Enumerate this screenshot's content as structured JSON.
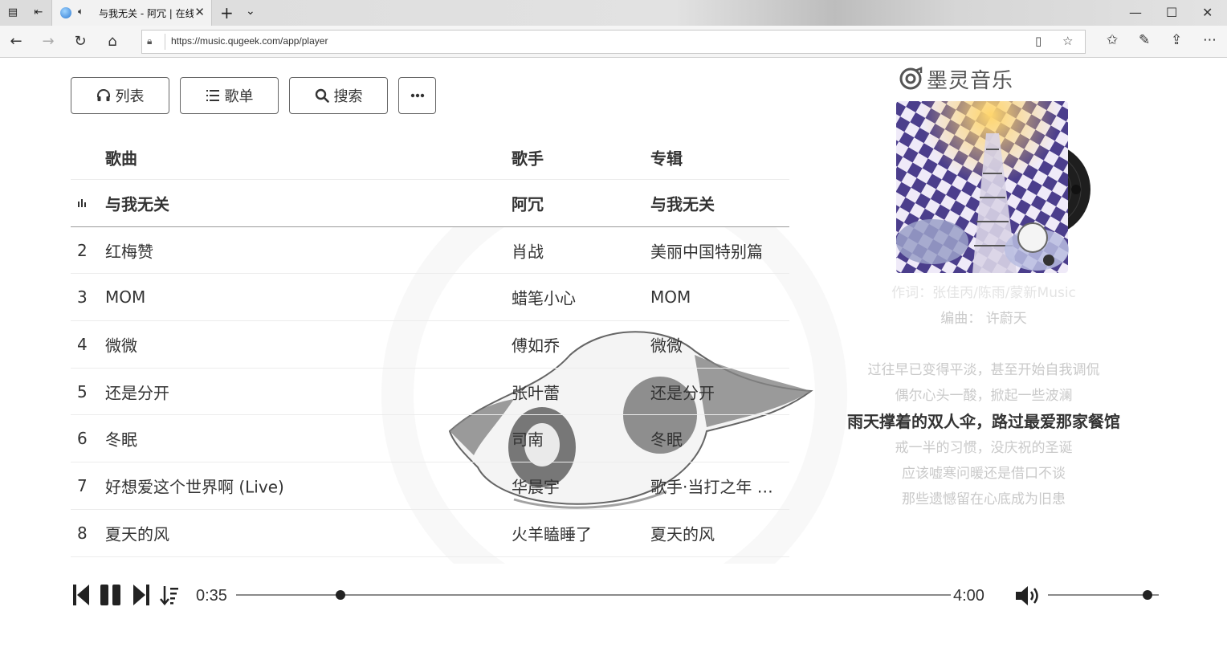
{
  "browser": {
    "tab_title": "与我无关 - 阿冗 | 在线音乐播放器",
    "url": "https://music.qugeek.com/app/player"
  },
  "nav_buttons": {
    "list": "列表",
    "playlist": "歌单",
    "search": "搜索"
  },
  "table": {
    "headers": {
      "song": "歌曲",
      "artist": "歌手",
      "album": "专辑"
    },
    "rows": [
      {
        "num": "",
        "song": "与我无关",
        "artist": "阿冗",
        "album": "与我无关",
        "playing": true
      },
      {
        "num": "2",
        "song": "红梅赞",
        "artist": "肖战",
        "album": "美丽中国特别篇"
      },
      {
        "num": "3",
        "song": "MOM",
        "artist": "蜡笔小心",
        "album": "MOM"
      },
      {
        "num": "4",
        "song": "微微",
        "artist": "傅如乔",
        "album": "微微"
      },
      {
        "num": "5",
        "song": "还是分开",
        "artist": "张叶蕾",
        "album": "还是分开"
      },
      {
        "num": "6",
        "song": "冬眠",
        "artist": "司南",
        "album": "冬眠"
      },
      {
        "num": "7",
        "song": "好想爱这个世界啊 (Live)",
        "artist": "华晨宇",
        "album": "歌手·当打之年 第..."
      },
      {
        "num": "8",
        "song": "夏天的风",
        "artist": "火羊瞌睡了",
        "album": "夏天的风"
      }
    ]
  },
  "app": {
    "logo_text": "墨灵音乐"
  },
  "lyrics": {
    "lines": [
      "作词：张佳丙/陈雨/蒙新Music",
      "编曲： 许蔚天",
      "",
      "过往早已变得平淡，甚至开始自我调侃",
      "偶尔心头一酸，掀起一些波澜",
      "雨天撑着的双人伞，路过最爱那家餐馆",
      "戒一半的习惯，没庆祝的圣诞",
      "应该嘘寒问暖还是借口不谈",
      "那些遗憾留在心底成为旧患"
    ],
    "current_index": 5
  },
  "player": {
    "current_time": "0:35",
    "total_time": "4:00",
    "progress": 0.146,
    "volume": 0.9
  }
}
